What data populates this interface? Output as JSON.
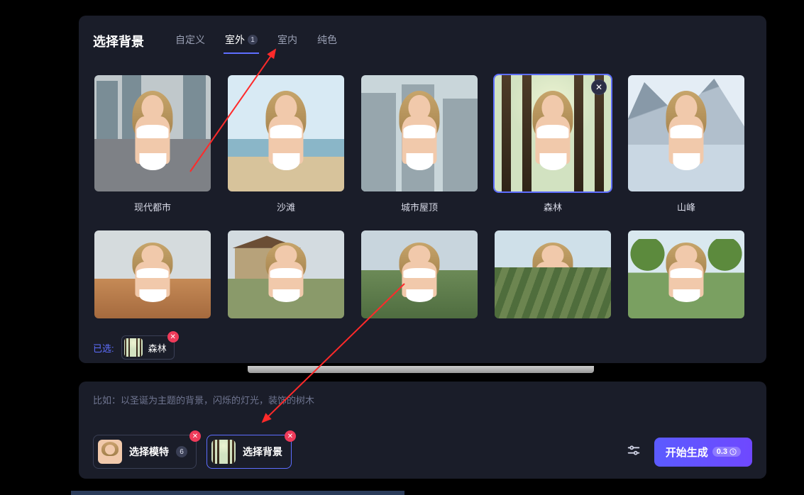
{
  "panel": {
    "title": "选择背景",
    "tabs": [
      {
        "label": "自定义",
        "active": false
      },
      {
        "label": "室外",
        "active": true,
        "badge": "1"
      },
      {
        "label": "室内",
        "active": false
      },
      {
        "label": "纯色",
        "active": false
      }
    ]
  },
  "backgrounds_row1": [
    {
      "label": "现代都市",
      "scene": "city",
      "selected": false
    },
    {
      "label": "沙滩",
      "scene": "beach",
      "selected": false
    },
    {
      "label": "城市屋顶",
      "scene": "roof",
      "selected": false
    },
    {
      "label": "森林",
      "scene": "forest",
      "selected": true
    },
    {
      "label": "山峰",
      "scene": "mountain",
      "selected": false
    }
  ],
  "backgrounds_row2": [
    {
      "scene": "desert"
    },
    {
      "scene": "barn"
    },
    {
      "scene": "hill"
    },
    {
      "scene": "vine"
    },
    {
      "scene": "park"
    }
  ],
  "selected": {
    "label": "已选:",
    "chip": "森林"
  },
  "hint": "比如：以圣诞为主题的背景，闪烁的灯光，装饰的树木",
  "pickers": {
    "model": {
      "label": "选择模特",
      "count": "6"
    },
    "background": {
      "label": "选择背景"
    }
  },
  "generate": {
    "label": "开始生成",
    "badge": "0.3"
  },
  "colors": {
    "accent": "#5e6eff",
    "danger": "#ef3b5a"
  }
}
